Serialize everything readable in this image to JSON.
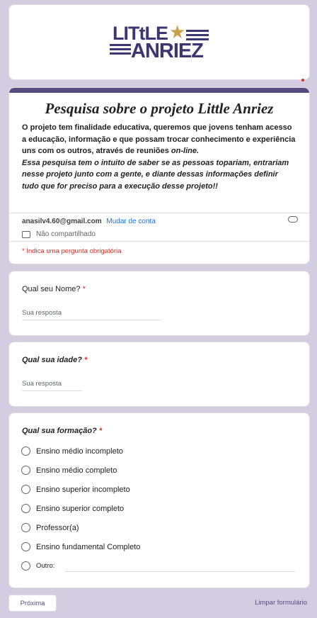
{
  "banner": {
    "logo_line1": "LITtLE",
    "logo_line2": "ANRIEZ"
  },
  "form": {
    "title": "Pesquisa sobre o projeto Little Anriez",
    "desc_part1": "O projeto tem finalidade educativa, queremos que jovens tenham acesso a educação, informação e que possam trocar conhecimento e experiência uns com os outros, através de reuniões ",
    "desc_online": "on-line.",
    "desc_part2": "Essa pesquisa tem o intuito de saber se as pessoas topariam, entrariam nesse projeto junto com a gente, e diante dessas informações definir tudo que for preciso para a execução desse projeto!!",
    "account_email": "anasilv4.60@gmail.com",
    "switch_account": "Mudar de conta",
    "not_shared": "Não compartilhado",
    "required_note": "* Indica uma pergunta obrigatória"
  },
  "questions": {
    "name": {
      "title": "Qual seu Nome?",
      "required": "*",
      "placeholder": "Sua resposta"
    },
    "age": {
      "title": "Qual sua idade?",
      "required": "*",
      "placeholder": "Sua resposta"
    },
    "education": {
      "title": "Qual sua formação?",
      "required": "*",
      "options": [
        "Ensino médio incompleto",
        "Ensino médio completo",
        "Ensino superior incompleto",
        "Ensino superior completo",
        "Professor(a)",
        "Ensino fundamental Completo"
      ],
      "other_label": "Outro:"
    }
  },
  "footer": {
    "next_button": "Próxima",
    "clear_form": "Limpar formulário"
  },
  "colors": {
    "theme": "#5b4a7e",
    "background": "#d4cde1",
    "required": "#d93025",
    "link": "#1a73e8"
  }
}
